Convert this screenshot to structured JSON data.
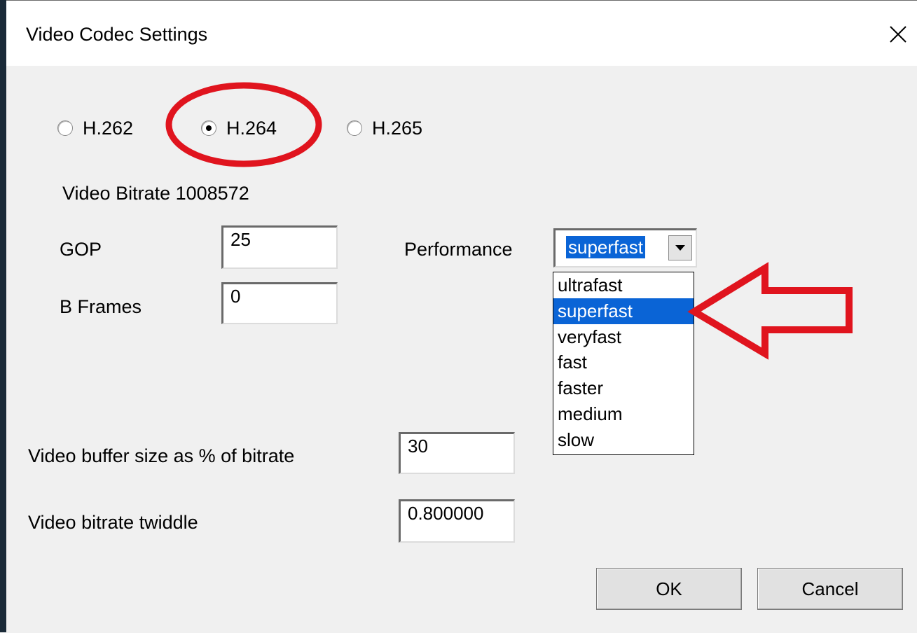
{
  "window": {
    "title": "Video Codec Settings"
  },
  "codecs": [
    {
      "label": "H.262",
      "checked": false
    },
    {
      "label": "H.264",
      "checked": true
    },
    {
      "label": "H.265",
      "checked": false
    }
  ],
  "bitrate_text": "Video Bitrate 1008572",
  "gop": {
    "label": "GOP",
    "value": "25"
  },
  "b_frames": {
    "label": "B Frames",
    "value": "0"
  },
  "performance": {
    "label": "Performance",
    "selected": "superfast",
    "options": [
      "ultrafast",
      "superfast",
      "veryfast",
      "fast",
      "faster",
      "medium",
      "slow"
    ]
  },
  "buffer": {
    "label": "Video buffer size as % of bitrate",
    "value": "30"
  },
  "twiddle": {
    "label": "Video bitrate twiddle",
    "value": "0.800000"
  },
  "buttons": {
    "ok": "OK",
    "cancel": "Cancel"
  },
  "annotation_color": "#e0141e"
}
